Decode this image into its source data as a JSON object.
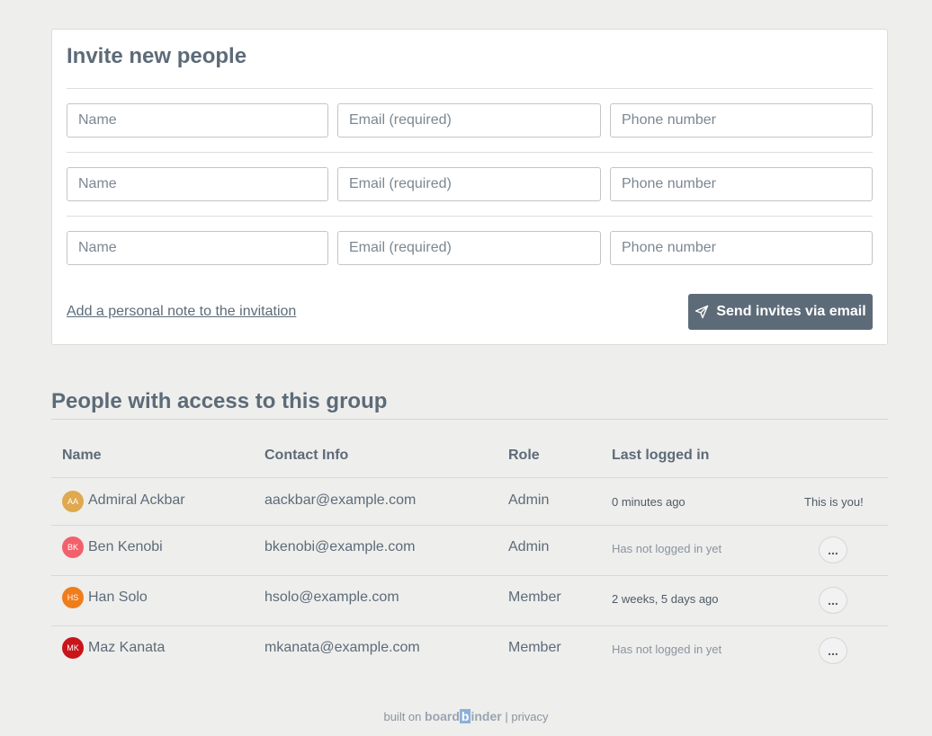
{
  "invite": {
    "title": "Invite new people",
    "rows": [
      {
        "name_placeholder": "Name",
        "email_placeholder": "Email (required)",
        "phone_placeholder": "Phone number"
      },
      {
        "name_placeholder": "Name",
        "email_placeholder": "Email (required)",
        "phone_placeholder": "Phone number"
      },
      {
        "name_placeholder": "Name",
        "email_placeholder": "Email (required)",
        "phone_placeholder": "Phone number"
      }
    ],
    "note_link": "Add a personal note to the invitation",
    "send_label": "Send invites via email"
  },
  "people": {
    "title": "People with access to this group",
    "headers": {
      "name": "Name",
      "contact": "Contact Info",
      "role": "Role",
      "last": "Last logged in"
    },
    "rows": [
      {
        "initials": "AA",
        "avatar_color": "#e0a84f",
        "name": "Admiral Ackbar",
        "email": "aackbar@example.com",
        "role": "Admin",
        "last": "0 minutes ago",
        "action": "This is you!"
      },
      {
        "initials": "BK",
        "avatar_color": "#f2616b",
        "name": "Ben Kenobi",
        "email": "bkenobi@example.com",
        "role": "Admin",
        "last": "Has not logged in yet",
        "action": "..."
      },
      {
        "initials": "HS",
        "avatar_color": "#f07d1c",
        "name": "Han Solo",
        "email": "hsolo@example.com",
        "role": "Member",
        "last": "2 weeks, 5 days ago",
        "action": "..."
      },
      {
        "initials": "MK",
        "avatar_color": "#c9141a",
        "name": "Maz Kanata",
        "email": "mkanata@example.com",
        "role": "Member",
        "last": "Has not logged in yet",
        "action": "..."
      }
    ]
  },
  "footer": {
    "built_on": "built on",
    "brand_pre": "board",
    "brand_b": "b",
    "brand_post": "inder",
    "separator": "|",
    "privacy": "privacy"
  }
}
